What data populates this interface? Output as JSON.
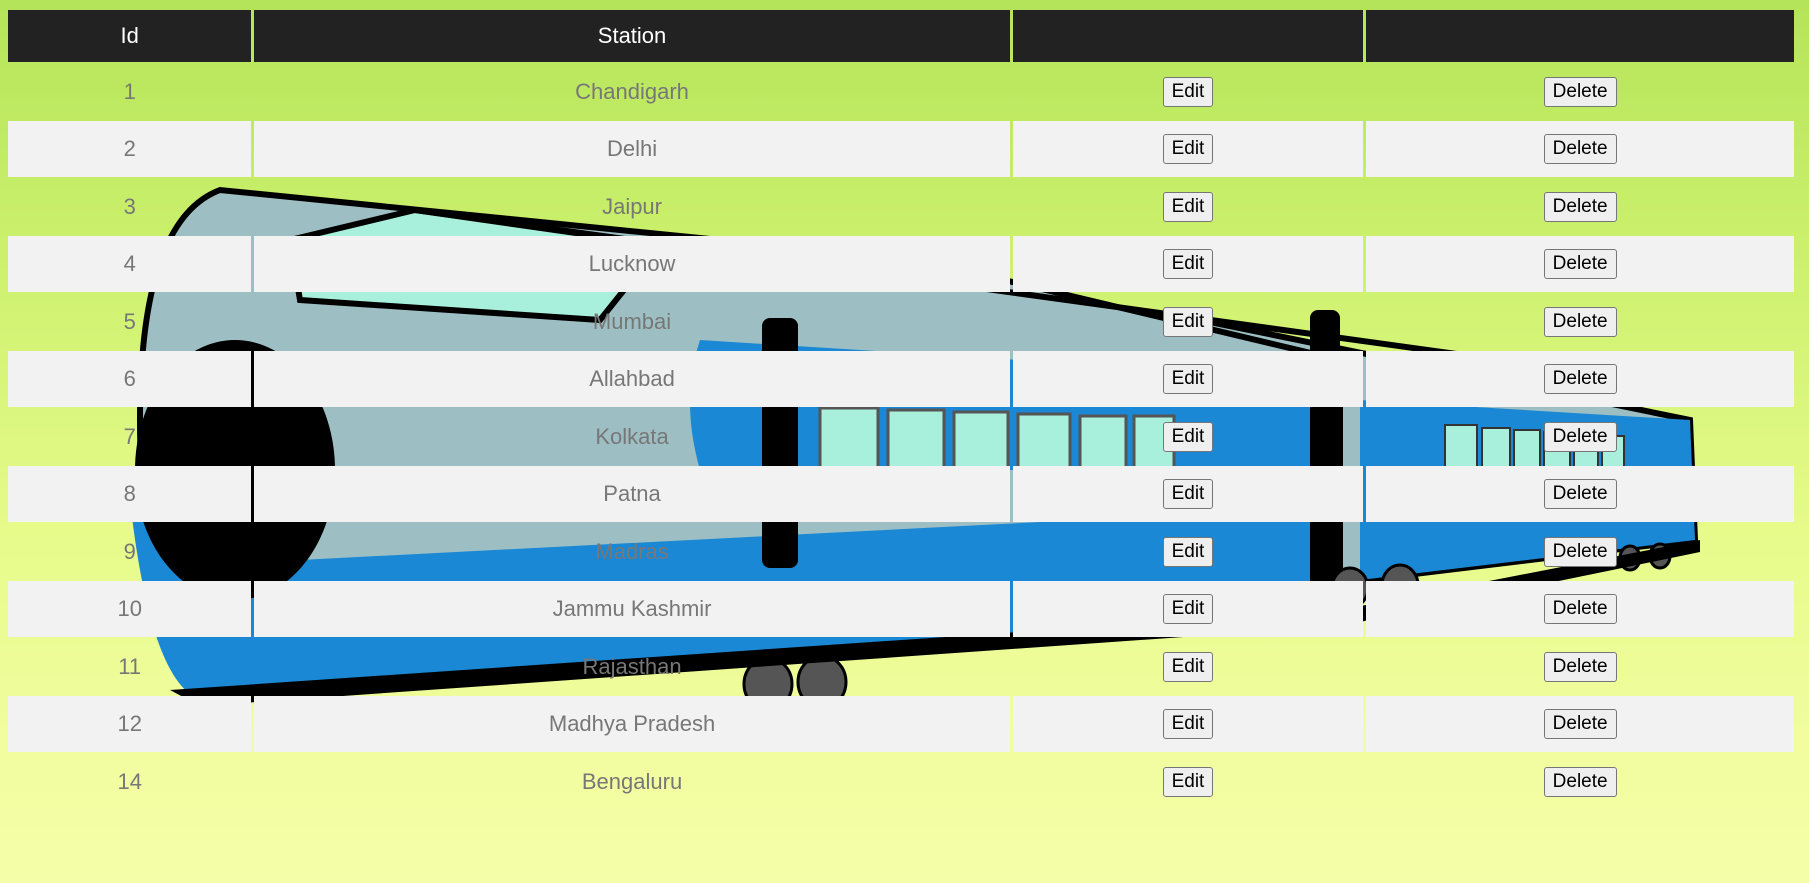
{
  "table": {
    "headers": {
      "id": "Id",
      "station": "Station",
      "edit": "",
      "delete": ""
    },
    "rows": [
      {
        "id": "1",
        "station": "Chandigarh",
        "edit": "Edit",
        "delete": "Delete"
      },
      {
        "id": "2",
        "station": "Delhi",
        "edit": "Edit",
        "delete": "Delete"
      },
      {
        "id": "3",
        "station": "Jaipur",
        "edit": "Edit",
        "delete": "Delete"
      },
      {
        "id": "4",
        "station": "Lucknow",
        "edit": "Edit",
        "delete": "Delete"
      },
      {
        "id": "5",
        "station": "Mumbai",
        "edit": "Edit",
        "delete": "Delete"
      },
      {
        "id": "6",
        "station": "Allahbad",
        "edit": "Edit",
        "delete": "Delete"
      },
      {
        "id": "7",
        "station": "Kolkata",
        "edit": "Edit",
        "delete": "Delete"
      },
      {
        "id": "8",
        "station": "Patna",
        "edit": "Edit",
        "delete": "Delete"
      },
      {
        "id": "9",
        "station": "Madras",
        "edit": "Edit",
        "delete": "Delete"
      },
      {
        "id": "10",
        "station": "Jammu Kashmir",
        "edit": "Edit",
        "delete": "Delete"
      },
      {
        "id": "11",
        "station": "Rajasthan",
        "edit": "Edit",
        "delete": "Delete"
      },
      {
        "id": "12",
        "station": "Madhya Pradesh",
        "edit": "Edit",
        "delete": "Delete"
      },
      {
        "id": "14",
        "station": "Bengaluru",
        "edit": "Edit",
        "delete": "Delete"
      }
    ]
  },
  "background": {
    "icon": "train-icon",
    "colors": {
      "gradient_top": "#b4e45a",
      "gradient_bottom": "#f4fea8",
      "train_body": "#9dbfc3",
      "train_stripe": "#1a88d4",
      "train_window": "#a8f0dc",
      "header_bg": "#222222",
      "even_row_bg": "#f2f2f2"
    }
  }
}
